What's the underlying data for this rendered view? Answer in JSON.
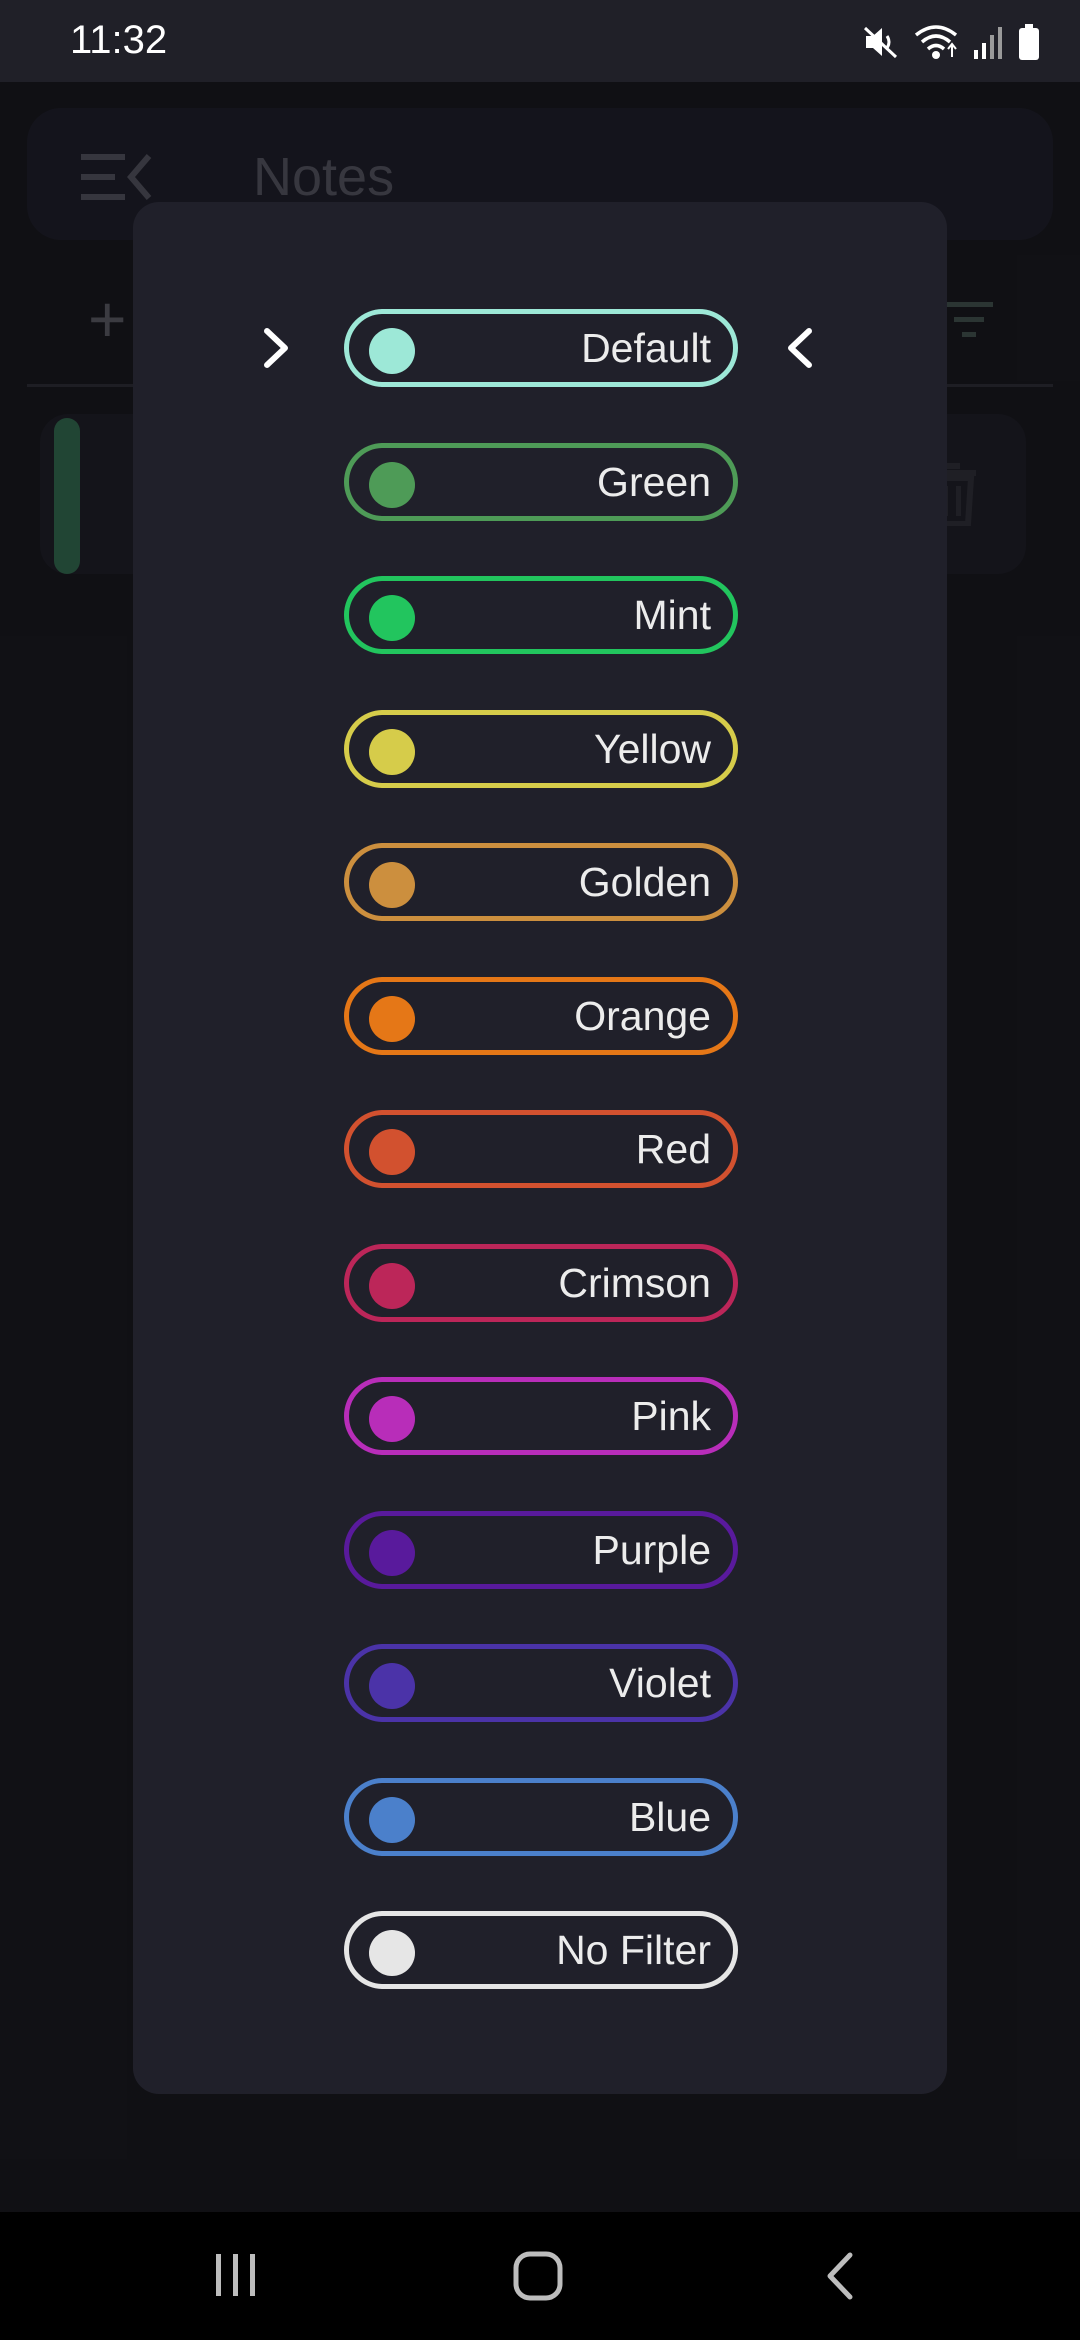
{
  "status_bar": {
    "time": "11:32",
    "icons": [
      "mute-icon",
      "wifi-icon",
      "signal-icon",
      "battery-icon"
    ]
  },
  "app": {
    "title": "Notes",
    "add_label": "+",
    "icons": [
      "menu-icon",
      "filter-icon",
      "delete-icon"
    ]
  },
  "color_filter": {
    "selected": "Default",
    "options": [
      {
        "label": "Default",
        "color": "#9de8d7"
      },
      {
        "label": "Green",
        "color": "#4e9b57"
      },
      {
        "label": "Mint",
        "color": "#22c55e"
      },
      {
        "label": "Yellow",
        "color": "#d6cc4a"
      },
      {
        "label": "Golden",
        "color": "#cc8f3e"
      },
      {
        "label": "Orange",
        "color": "#e57717"
      },
      {
        "label": "Red",
        "color": "#d2512f"
      },
      {
        "label": "Crimson",
        "color": "#bc2659"
      },
      {
        "label": "Pink",
        "color": "#b82db9"
      },
      {
        "label": "Purple",
        "color": "#591a9c"
      },
      {
        "label": "Violet",
        "color": "#4b33a8"
      },
      {
        "label": "Blue",
        "color": "#4b80cb"
      },
      {
        "label": "No Filter",
        "color": "#e6e6e6"
      }
    ]
  },
  "nav_bar": {
    "icons": [
      "recents-icon",
      "home-icon",
      "back-icon"
    ]
  }
}
